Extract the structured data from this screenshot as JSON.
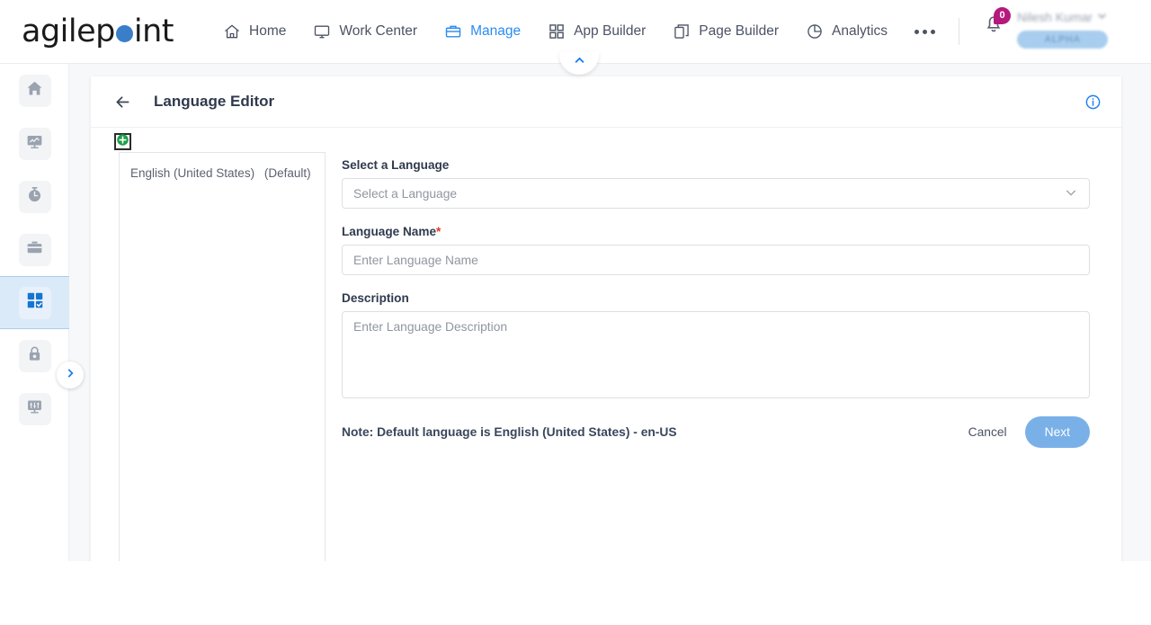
{
  "brand": {
    "text_before": "agilep",
    "text_after": "int"
  },
  "topnav": {
    "items": [
      {
        "label": "Home",
        "icon": "home-icon",
        "active": false
      },
      {
        "label": "Work Center",
        "icon": "monitor-icon",
        "active": false
      },
      {
        "label": "Manage",
        "icon": "briefcase-icon",
        "active": true
      },
      {
        "label": "App Builder",
        "icon": "grid-icon",
        "active": false
      },
      {
        "label": "Page Builder",
        "icon": "pages-icon",
        "active": false
      },
      {
        "label": "Analytics",
        "icon": "pie-chart-icon",
        "active": false
      }
    ],
    "more_label": "more-options",
    "notification_count": "0",
    "user_name": "Nilesh Kumar",
    "alpha_badge": "ALPHA"
  },
  "rail": {
    "items": [
      {
        "name": "sidebar-item-home",
        "icon": "home-icon",
        "active": false
      },
      {
        "name": "sidebar-item-reports",
        "icon": "chart-monitor-icon",
        "active": false
      },
      {
        "name": "sidebar-item-activity",
        "icon": "stopwatch-icon",
        "active": false
      },
      {
        "name": "sidebar-item-toolbox",
        "icon": "briefcase-icon",
        "active": false
      },
      {
        "name": "sidebar-item-apps",
        "icon": "app-grid-check-icon",
        "active": true
      },
      {
        "name": "sidebar-item-access",
        "icon": "lock-icon",
        "active": false
      },
      {
        "name": "sidebar-item-settings",
        "icon": "sliders-icon",
        "active": false
      }
    ]
  },
  "page": {
    "title": "Language Editor",
    "back_label": "back-arrow",
    "info_label": "information",
    "add_label": "add-language"
  },
  "language_list": [
    {
      "name": "English (United States)",
      "default_tag": "(Default)"
    }
  ],
  "form": {
    "select_language_label": "Select a Language",
    "select_language_placeholder": "Select a Language",
    "language_name_label": "Language Name",
    "language_name_required": "*",
    "language_name_placeholder": "Enter Language Name",
    "description_label": "Description",
    "description_placeholder": "Enter Language Description",
    "note": "Note: Default language is English (United States) - en-US",
    "cancel_label": "Cancel",
    "next_label": "Next"
  },
  "colors": {
    "accent_blue": "#2a8bf2",
    "brand_dot": "#3a7dc9",
    "next_button": "#79b0e8",
    "badge_magenta": "#b5197d",
    "required_red": "#e8342a",
    "add_green": "#1e9e4a",
    "active_rail_bg": "#dbeaf8"
  }
}
